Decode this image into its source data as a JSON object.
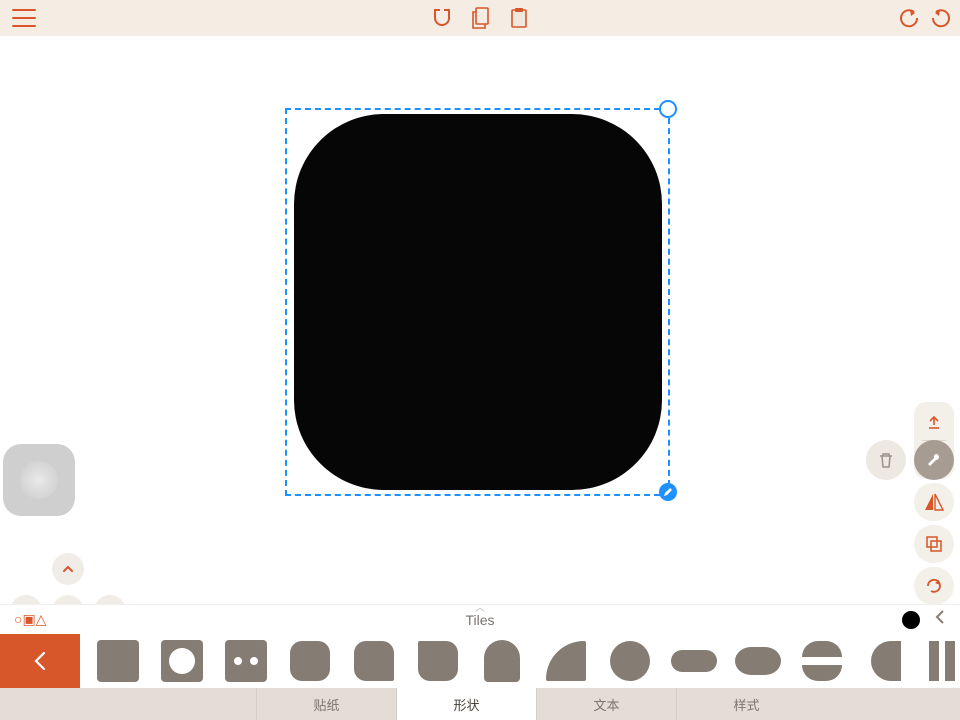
{
  "panel": {
    "title": "Tiles",
    "mode_glyphs": "○▣△"
  },
  "tabs": {
    "stickers": "贴纸",
    "shapes": "形状",
    "text": "文本",
    "style": "样式"
  },
  "shape_tiles": [
    "square",
    "square-hole",
    "square-dots",
    "rounded-square",
    "leaf-1",
    "leaf-2",
    "pill-tall",
    "quarter",
    "circle",
    "pill",
    "bean",
    "ring",
    "moon",
    "bars"
  ],
  "colors": {
    "current_fill": "#000000"
  }
}
